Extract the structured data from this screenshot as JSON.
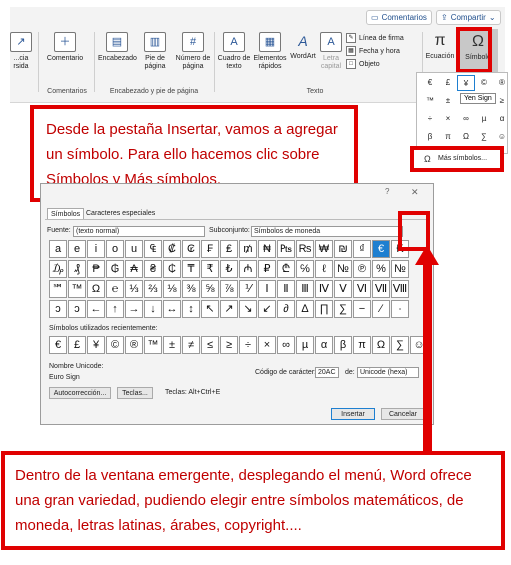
{
  "ribbon": {
    "comentarios_btn": "Comentarios",
    "compartir_btn": "Compartir",
    "items": [
      {
        "label": "...cia\nrsida"
      },
      {
        "label": "Comentario"
      },
      {
        "label": "Encabezado"
      },
      {
        "label": "Pie de\npágina"
      },
      {
        "label": "Número de\npágina"
      },
      {
        "label": "Cuadro de\ntexto"
      },
      {
        "label": "Elementos\nrápidos"
      },
      {
        "label": "WordArt"
      },
      {
        "label": "Letra\ncapital"
      },
      {
        "label": "Ecuación"
      },
      {
        "label": "Símbolo"
      }
    ],
    "small_items": [
      "Línea de firma",
      "Fecha y hora",
      "Objeto"
    ],
    "groups": [
      "Comentarios",
      "Encabezado y pie de página",
      "Texto"
    ]
  },
  "symbol_dropdown": {
    "symbols": [
      "€",
      "£",
      "¥",
      "©",
      "®",
      "™",
      "±",
      "≠",
      "≤",
      "≥",
      "÷",
      "×",
      "∞",
      "µ",
      "α",
      "β",
      "π",
      "Ω",
      "∑",
      "☺"
    ],
    "tooltip": "Yen Sign",
    "more": "Más símbolos..."
  },
  "callout_top": "Desde la pestaña Insertar, vamos a agregar un símbolo. Para ello hacemos clic sobre Símbolos y Más símbolos.",
  "callout_bottom": "Dentro de la ventana emergente, desplegando el menú, Word ofrece una gran variedad, pudiendo elegir entre símbolos matemáticos, de moneda, letras latinas, árabes, copyright....",
  "dialog": {
    "tabs": [
      "Símbolos",
      "Caracteres especiales"
    ],
    "font_label": "Fuente:",
    "font_value": "(texto normal)",
    "subset_label": "Subconjunto:",
    "subset_value": "Símbolos de moneda",
    "grid": [
      [
        "a",
        "e",
        "i",
        "o",
        "u",
        "₠",
        "₡",
        "₢",
        "₣",
        "₤",
        "₥",
        "₦",
        "₧",
        "₨",
        "₩",
        "₪",
        "₫",
        "€",
        "₭"
      ],
      [
        "₯",
        "₰",
        "₱",
        "₲",
        "₳",
        "₴",
        "₵",
        "₸",
        "₹",
        "₺",
        "₼",
        "₽",
        "₾",
        "℅",
        "ℓ",
        "№",
        "℗",
        "%",
        "№"
      ],
      [
        "℠",
        "™",
        "Ω",
        "℮",
        "⅓",
        "⅔",
        "⅛",
        "⅜",
        "⅝",
        "⅞",
        "⅟",
        "Ⅰ",
        "Ⅱ",
        "Ⅲ",
        "Ⅳ",
        "Ⅴ",
        "Ⅵ",
        "Ⅶ",
        "Ⅷ"
      ],
      [
        "ↄ",
        "ↄ",
        "←",
        "↑",
        "→",
        "↓",
        "↔",
        "↕",
        "↖",
        "↗",
        "↘",
        "↙",
        "∂",
        "∆",
        "∏",
        "∑",
        "−",
        "∕",
        "∙"
      ]
    ],
    "recent_label": "Símbolos utilizados recientemente:",
    "recent": [
      "€",
      "£",
      "¥",
      "©",
      "®",
      "™",
      "±",
      "≠",
      "≤",
      "≥",
      "÷",
      "×",
      "∞",
      "µ",
      "α",
      "β",
      "π",
      "Ω",
      "∑",
      "☺"
    ],
    "unicode_name_label": "Nombre Unicode:",
    "unicode_name": "Euro Sign",
    "char_code_label": "Código de carácter:",
    "char_code": "20AC",
    "de_label": "de:",
    "de_value": "Unicode (hexa)",
    "autocorrect_btn": "Autocorrección...",
    "teclas_btn": "Teclas...",
    "teclas_text": "Teclas: Alt+Ctrl+E",
    "insert_btn": "Insertar",
    "cancel_btn": "Cancelar",
    "help": "?",
    "close": "✕"
  },
  "colors": {
    "accent": "#e00000",
    "text": "#c00000",
    "selected": "#1e7fd0"
  }
}
